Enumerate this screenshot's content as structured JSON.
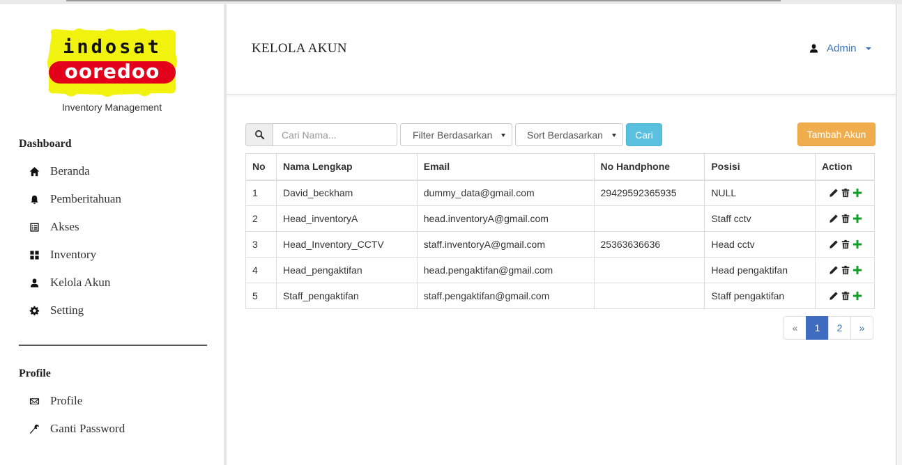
{
  "brand": {
    "logo_line1": "indosat",
    "logo_line2": "ooredoo",
    "subtitle": "Inventory Management",
    "colors": {
      "yellow": "#f2f20f",
      "red": "#e3001b"
    }
  },
  "sidebar": {
    "dashboard_heading": "Dashboard",
    "dashboard_items": [
      {
        "label": "Beranda",
        "icon": "home-icon"
      },
      {
        "label": "Pemberitahuan",
        "icon": "bell-icon"
      },
      {
        "label": "Akses",
        "icon": "list-icon"
      },
      {
        "label": "Inventory",
        "icon": "grid-icon"
      },
      {
        "label": "Kelola Akun",
        "icon": "user-icon"
      },
      {
        "label": "Setting",
        "icon": "gear-icon"
      }
    ],
    "profile_heading": "Profile",
    "profile_items": [
      {
        "label": "Profile",
        "icon": "envelope-icon"
      },
      {
        "label": "Ganti Password",
        "icon": "wrench-icon"
      }
    ]
  },
  "header": {
    "title": "KELOLA AKUN",
    "user_label": "Admin"
  },
  "toolbar": {
    "search_placeholder": "Cari Nama...",
    "filter_label": "Filter Berdasarkan",
    "sort_label": "Sort Berdasarkan",
    "search_button": "Cari",
    "add_button": "Tambah Akun",
    "colors": {
      "info": "#5bc0de",
      "warning": "#f0ad4e"
    }
  },
  "table": {
    "headers": [
      "No",
      "Nama Lengkap",
      "Email",
      "No Handphone",
      "Posisi",
      "Action"
    ],
    "rows": [
      {
        "no": "1",
        "name": "David_beckham",
        "email": "dummy_data@gmail.com",
        "phone": "29429592365935",
        "position": "NULL"
      },
      {
        "no": "2",
        "name": "Head_inventoryA",
        "email": "head.inventoryA@gmail.com",
        "phone": "",
        "position": "Staff cctv"
      },
      {
        "no": "3",
        "name": "Head_Inventory_CCTV",
        "email": "staff.inventoryA@gmail.com",
        "phone": "25363636636",
        "position": "Head cctv"
      },
      {
        "no": "4",
        "name": "Head_pengaktifan",
        "email": "head.pengaktifan@gmail.com",
        "phone": "",
        "position": "Head pengaktifan"
      },
      {
        "no": "5",
        "name": "Staff_pengaktifan",
        "email": "staff.pengaktifan@gmail.com",
        "phone": "",
        "position": "Staff pengaktifan"
      }
    ],
    "action_icons": [
      "pencil-icon",
      "trash-icon",
      "plus-icon"
    ]
  },
  "pagination": {
    "prev": "«",
    "pages": [
      "1",
      "2"
    ],
    "current": "1",
    "next": "»",
    "colors": {
      "active": "#3f6cbf"
    }
  }
}
